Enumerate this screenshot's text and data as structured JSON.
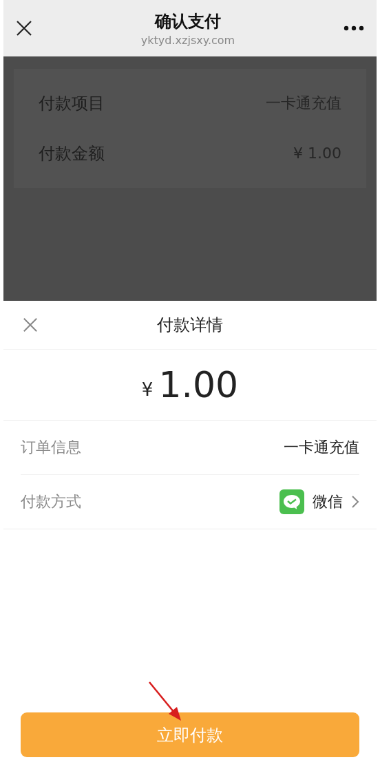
{
  "header": {
    "title": "确认支付",
    "url": "yktyd.xzjsxy.com"
  },
  "background_card": {
    "rows": [
      {
        "label": "付款项目",
        "value": "一卡通充值"
      },
      {
        "label": "付款金额",
        "value": "¥ 1.00"
      }
    ]
  },
  "sheet": {
    "title": "付款详情",
    "currency": "¥",
    "amount": "1.00",
    "rows": [
      {
        "kind": "text",
        "label": "订单信息",
        "value": "一卡通充值"
      },
      {
        "kind": "method",
        "label": "付款方式",
        "value": "微信"
      }
    ],
    "pay_button": "立即付款"
  }
}
